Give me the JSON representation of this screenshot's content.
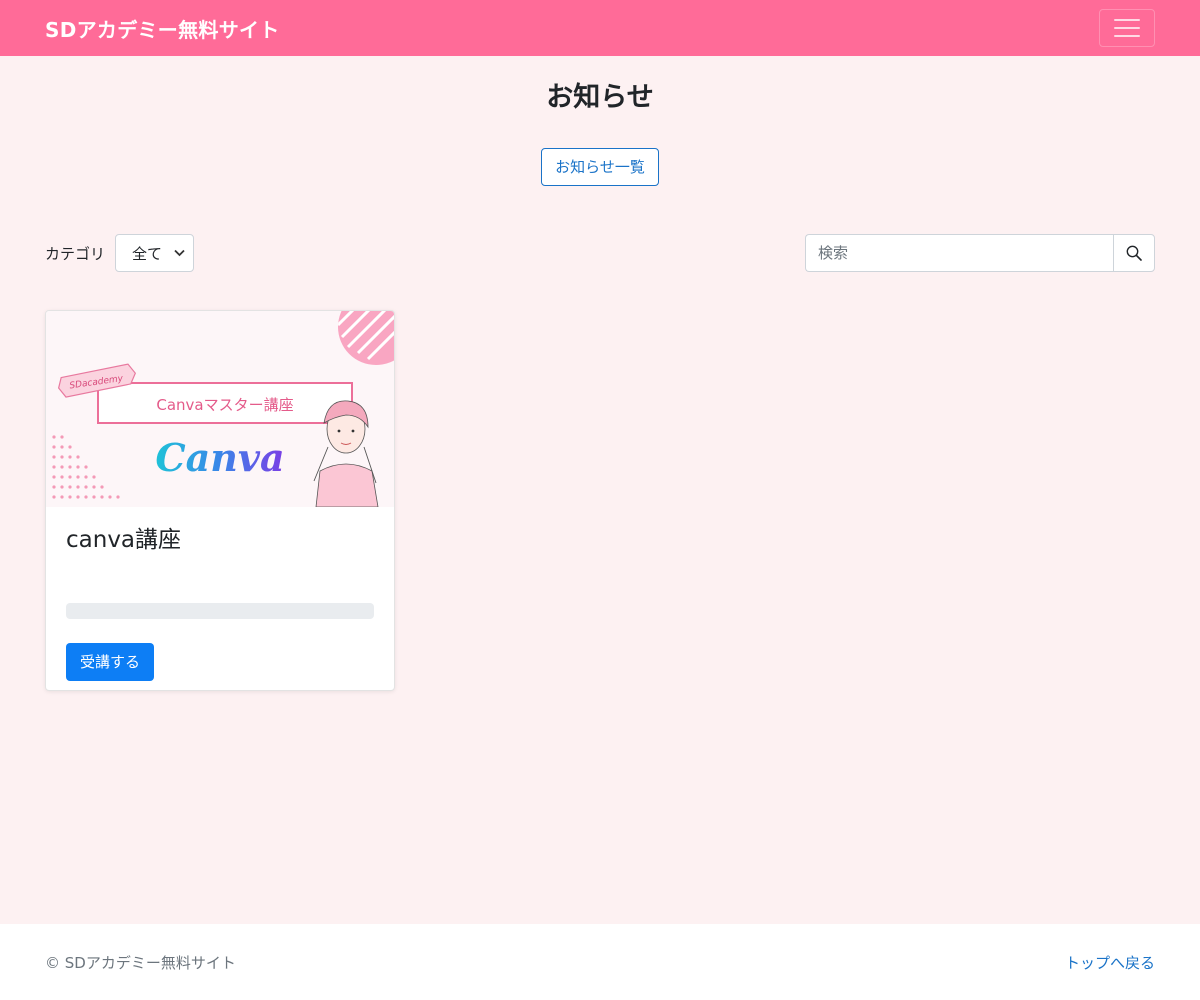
{
  "navbar": {
    "brand": "SDアカデミー無料サイト",
    "menu_icon": "hamburger-icon"
  },
  "page": {
    "title": "お知らせ",
    "list_button": "お知らせ一覧"
  },
  "filter": {
    "category_label": "カテゴリ",
    "category_selected": "全て",
    "search_placeholder": "検索",
    "search_icon": "search-icon"
  },
  "courses": [
    {
      "thumbnail": {
        "badge": "SDacademy",
        "banner": "Canvaマスター講座",
        "logo": "Canva"
      },
      "title": "canva講座",
      "button": "受講する"
    }
  ],
  "footer": {
    "copyright": "© SDアカデミー無料サイト",
    "top_link": "トップへ戻る"
  },
  "colors": {
    "navbar": "#ff6b98",
    "background": "#fdf1f2",
    "primary": "#0d7ef5",
    "link": "#1a73c8"
  }
}
